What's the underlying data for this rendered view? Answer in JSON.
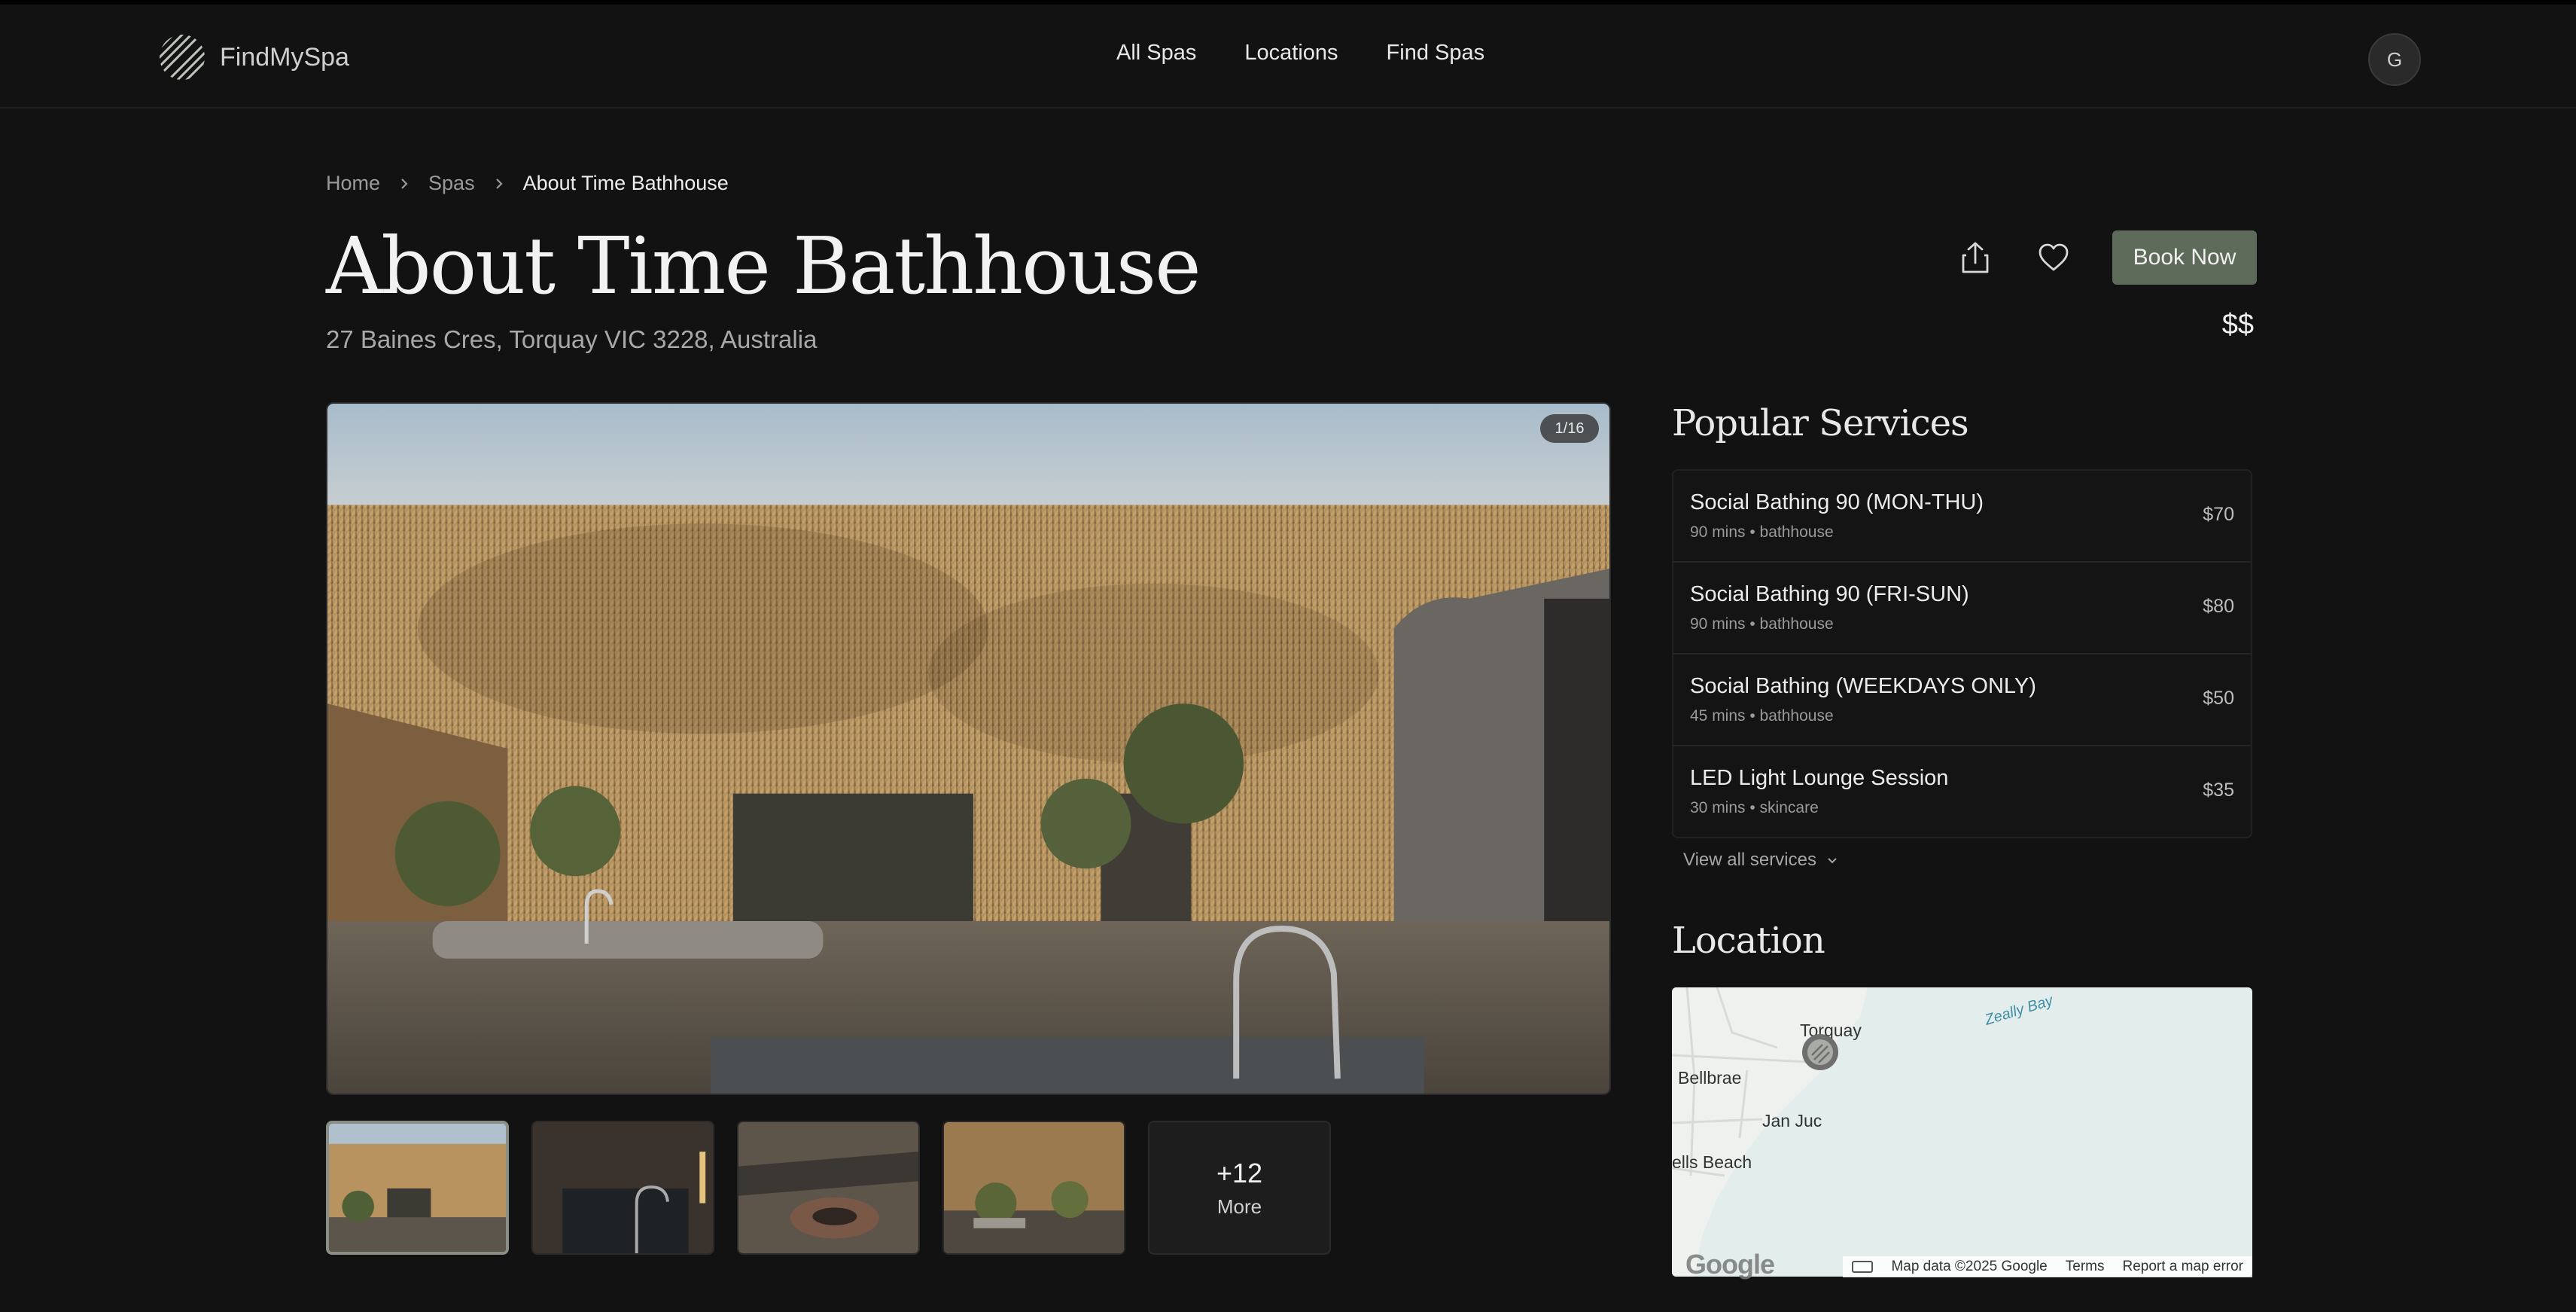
{
  "brand": {
    "name": "FindMySpa",
    "logo_icon": "striped-circle-logo"
  },
  "nav": {
    "items": [
      "All Spas",
      "Locations",
      "Find Spas"
    ]
  },
  "user": {
    "initial": "G"
  },
  "breadcrumb": {
    "items": [
      "Home",
      "Spas"
    ],
    "current": "About Time Bathhouse"
  },
  "spa": {
    "name": "About Time Bathhouse",
    "address": "27 Baines Cres, Torquay VIC 3228, Australia",
    "price_level": "$$",
    "book_label": "Book Now"
  },
  "gallery": {
    "counter": "1/16",
    "more_count": "+12",
    "more_label": "More"
  },
  "services": {
    "title": "Popular Services",
    "items": [
      {
        "name": "Social Bathing 90 (MON-THU)",
        "meta": "90 mins • bathhouse",
        "price": "$70"
      },
      {
        "name": "Social Bathing 90 (FRI-SUN)",
        "meta": "90 mins • bathhouse",
        "price": "$80"
      },
      {
        "name": "Social Bathing (WEEKDAYS ONLY)",
        "meta": "45 mins • bathhouse",
        "price": "$50"
      },
      {
        "name": "LED Light Lounge Session",
        "meta": "30 mins • skincare",
        "price": "$35"
      }
    ],
    "view_all": "View all services"
  },
  "location": {
    "title": "Location",
    "map": {
      "labels": [
        "Torquay",
        "Zeally Bay",
        "Bellbrae",
        "Jan Juc",
        "ells Beach"
      ],
      "google": "Google",
      "map_data": "Map data ©2025 Google",
      "terms": "Terms",
      "report": "Report a map error"
    }
  },
  "colors": {
    "background": "#121212",
    "accent": "#5f6b5a",
    "water": "#e3eeec"
  }
}
